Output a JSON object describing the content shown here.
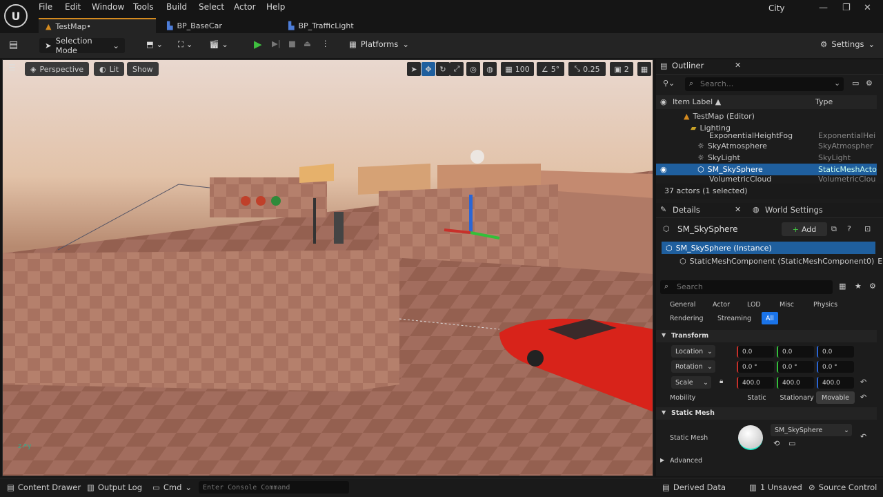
{
  "menu": [
    "File",
    "Edit",
    "Window",
    "Tools",
    "Build",
    "Select",
    "Actor",
    "Help"
  ],
  "project": "City",
  "tabs": [
    {
      "label": "TestMap•",
      "active": true
    },
    {
      "label": "BP_BaseCar",
      "active": false
    },
    {
      "label": "BP_TrafficLight",
      "active": false
    }
  ],
  "toolbar": {
    "mode": "Selection Mode",
    "platforms": "Platforms",
    "settings": "Settings"
  },
  "viewport": {
    "perspective": "Perspective",
    "lit": "Lit",
    "show": "Show",
    "grid": "100",
    "angle": "5°",
    "scale": "0.25",
    "cams": "2"
  },
  "outliner": {
    "title": "Outliner",
    "search_placeholder": "Search...",
    "col_label": "Item Label ▲",
    "col_type": "Type",
    "items": [
      {
        "label": "TestMap (Editor)",
        "type": ""
      },
      {
        "label": "Lighting",
        "type": ""
      },
      {
        "label": "ExponentialHeightFog",
        "type": "ExponentialHei"
      },
      {
        "label": "SkyAtmosphere",
        "type": "SkyAtmospher"
      },
      {
        "label": "SkyLight",
        "type": "SkyLight"
      },
      {
        "label": "SM_SkySphere",
        "type": "StaticMeshActo"
      },
      {
        "label": "VolumetricCloud",
        "type": "VolumetricClou"
      }
    ],
    "count": "37 actors (1 selected)"
  },
  "details": {
    "tab1": "Details",
    "tab2": "World Settings",
    "actor": "SM_SkySphere",
    "add": "Add",
    "instance": "SM_SkySphere (Instance)",
    "component": "StaticMeshComponent (StaticMeshComponent0)",
    "component_suffix": "E",
    "search_placeholder": "Search",
    "filters": [
      "General",
      "Actor",
      "LOD",
      "Misc",
      "Physics",
      "Rendering",
      "Streaming",
      "All"
    ],
    "transform": "Transform",
    "location_label": "Location",
    "location": [
      "0.0",
      "0.0",
      "0.0"
    ],
    "rotation_label": "Rotation",
    "rotation": [
      "0.0 °",
      "0.0 °",
      "0.0 °"
    ],
    "scale_label": "Scale",
    "scale": [
      "400.0",
      "400.0",
      "400.0"
    ],
    "mobility_label": "Mobility",
    "mobility": [
      "Static",
      "Stationary",
      "Movable"
    ],
    "static_mesh_section": "Static Mesh",
    "static_mesh_label": "Static Mesh",
    "static_mesh_value": "SM_SkySphere",
    "advanced": "Advanced"
  },
  "status": {
    "content_drawer": "Content Drawer",
    "output_log": "Output Log",
    "cmd": "Cmd",
    "console_placeholder": "Enter Console Command",
    "derived": "Derived Data",
    "unsaved": "1 Unsaved",
    "source": "Source Control"
  },
  "colors": {
    "accent": "#d58b1f",
    "select": "#1f5f9e",
    "car": "#d8231a",
    "all_filter": "#1a73e8"
  }
}
